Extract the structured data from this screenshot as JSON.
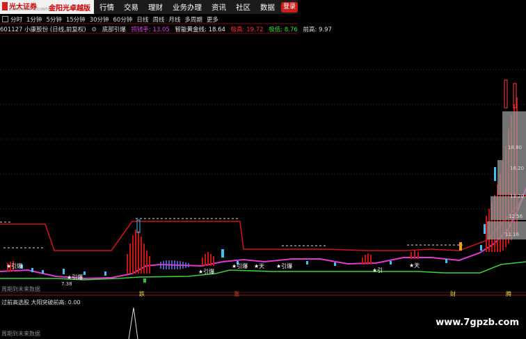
{
  "app": {
    "logo_text": "光大证券",
    "logo_subtext": "EVERBRIGHT SECURITIES",
    "product_name": "金阳光卓越版",
    "nav": [
      "行情",
      "交易",
      "理财",
      "业务办理",
      "资讯",
      "社区",
      "数据"
    ],
    "login_label": "登录"
  },
  "periods": [
    "分时",
    "1分钟",
    "5分钟",
    "15分钟",
    "30分钟",
    "60分钟",
    "日线",
    "周线",
    "月线",
    "多周期",
    "更多"
  ],
  "info": {
    "stock": "601127 小康股份 (日线,前复权)",
    "indicator": "底部引爆",
    "grab": "捞钱手: 13.05",
    "gold": "智能黄金线: 18.64",
    "high": "极高: 19.72",
    "low": "极低: 8.76",
    "prev_high": "前高: 9.97"
  },
  "chart_labels": {
    "future_data_1": "周期到未来数据",
    "future_data_2": "周期到未来数据",
    "indicator_row": "过前高选股  大阳突破前高: 0.00",
    "low_price": "7.38",
    "prices": [
      "18.80",
      "16.20",
      "13.20",
      "12.56",
      "11.16"
    ],
    "markers": [
      "跌",
      "涨",
      "财",
      "腾"
    ],
    "signals": [
      "★引爆",
      "★引爆",
      "★天",
      "★引爆",
      "★引爆",
      "★天",
      "★引爆",
      "★引"
    ]
  },
  "watermark": "www.7gpzb.com"
}
